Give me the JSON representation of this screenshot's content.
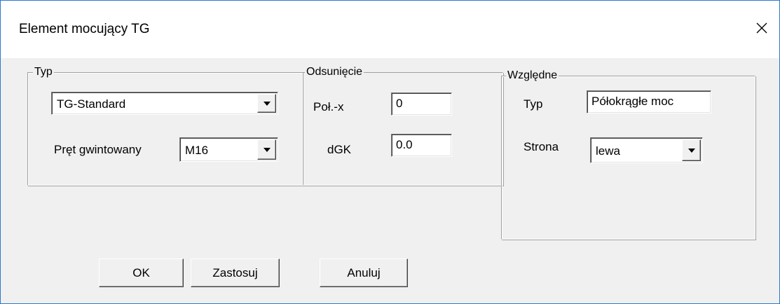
{
  "window": {
    "title": "Element mocujący TG",
    "close_symbol": "✕"
  },
  "groups": {
    "typ": {
      "legend": "Typ",
      "type_value": "TG-Standard",
      "rod_label": "Pręt gwintowany",
      "rod_value": "M16"
    },
    "odsuniecie": {
      "legend": "Odsunięcie",
      "polx_label": "Poł.-x",
      "polx_value": "0",
      "dgk_label": "dGK",
      "dgk_value": "0.0"
    },
    "wzgledne": {
      "legend": "Względne",
      "typ_label": "Typ",
      "typ_value": "Półokrągłe moc",
      "strona_label": "Strona",
      "strona_value": "lewa"
    }
  },
  "buttons": {
    "ok": "OK",
    "apply": "Zastosuj",
    "cancel": "Anuluj"
  },
  "icons": {
    "close": "close-icon",
    "dropdown": "chevron-down-icon"
  }
}
